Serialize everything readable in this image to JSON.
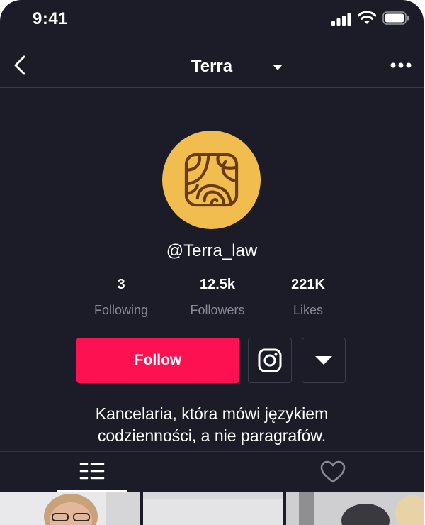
{
  "status_bar": {
    "time": "9:41"
  },
  "header": {
    "title": "Terra"
  },
  "profile": {
    "handle": "@Terra_law",
    "avatar_color": "#f1bd4f",
    "logo_color": "#6b3b10"
  },
  "stats": [
    {
      "value": "3",
      "label": "Following"
    },
    {
      "value": "12.5k",
      "label": "Followers"
    },
    {
      "value": "221K",
      "label": "Likes"
    }
  ],
  "actions": {
    "follow_label": "Follow",
    "follow_color": "#fe1150",
    "instagram_icon": "instagram-icon",
    "more_icon": "caret-down-icon"
  },
  "bio": {
    "line1": "Kancelaria, która mówi językiem",
    "line2": "codzienności, a nie paragrafów."
  },
  "tabs": [
    {
      "icon": "list-icon",
      "active": true
    },
    {
      "icon": "heart-icon",
      "active": false
    }
  ],
  "theme": {
    "background": "#1c1c28",
    "muted_text": "#8a8a96"
  }
}
